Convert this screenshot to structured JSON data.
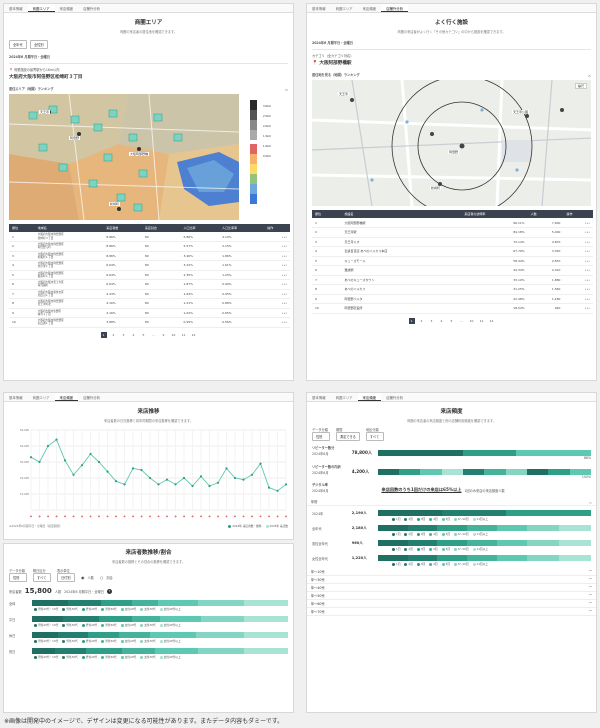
{
  "tabs": [
    "基本情報",
    "商圏エリア",
    "来店頻度",
    "店舗外分析"
  ],
  "p1": {
    "title": "商圏エリア",
    "subtitle": "商圏の来店者の居住地を確認できます。",
    "select_age": "全年代",
    "select_gender": "全性別",
    "period": "2024年6 月期平日・全曜日",
    "store_label": "商業施設の最寄駅から1Km以内",
    "store_name": "大阪府大阪市阿倍野区松崎町３丁目",
    "section": "居住エリア（地図）ランキング",
    "columns": [
      "順位",
      "地域名",
      "来店者数",
      "来店割合",
      "人口比率",
      "人口比率率",
      "操作"
    ],
    "rows": [
      [
        "1",
        "大阪府大阪市阿倍野区\n松崎町３丁目",
        "8.86%",
        "80",
        "5.86%",
        "4.10%"
      ],
      [
        "2",
        "大阪府大阪市阿倍野区\n阿倍野元町",
        "8.86%",
        "80",
        "5.57%",
        "2.15%"
      ],
      [
        "3",
        "大阪府大阪市阿倍野区\n昭和町１丁目",
        "8.86%",
        "80",
        "3.46%",
        "1.86%"
      ],
      [
        "4",
        "大阪府大阪市阿倍野区\n文の里１丁目",
        "6.64%",
        "80",
        "3.22%",
        "1.61%"
      ],
      [
        "5",
        "大阪府大阪市阿倍野区\n阪南町１丁目",
        "6.64%",
        "80",
        "2.35%",
        "1.25%"
      ],
      [
        "6",
        "大阪府大阪市天王寺区\n南河堀町",
        "6.64%",
        "80",
        "1.87%",
        "0.99%"
      ],
      [
        "7",
        "大阪府大阪市東住吉区\n北田辺１丁目",
        "4.43%",
        "80",
        "1.64%",
        "0.95%"
      ],
      [
        "8",
        "大阪府大阪市阿倍野区\n天王寺町北",
        "4.16%",
        "80",
        "1.21%",
        "0.88%"
      ],
      [
        "9",
        "大阪府大阪市生野区\n林寺１丁目",
        "4.16%",
        "80",
        "1.02%",
        "0.65%"
      ],
      [
        "10",
        "大阪府大阪市阿倍野区\n丸山通１丁目",
        "3.88%",
        "80",
        "0.99%",
        "0.56%"
      ]
    ],
    "pages": [
      "1",
      "2",
      "3",
      "4",
      "5",
      "…",
      "9",
      "10",
      "11",
      "12"
    ],
    "map_legend": [
      "3.0km",
      "2.5km",
      "2.0km",
      "1.5km",
      "1.0km",
      "0.5km"
    ],
    "stations": [
      "天王寺",
      "阿倍野",
      "大阪阿部野橋",
      "松崎町",
      "文の里"
    ]
  },
  "p2": {
    "title": "よく行く施設",
    "subtitle": "商圏の来店者がよく行く「その他カテゴリ」の中から施設を確認できます。",
    "period": "2024年6 月期平日・全曜日",
    "category_label": "カテゴリ（全カテゴリ対応）",
    "store_name": "大阪阿部野橋駅",
    "section": "居住地を見る（地図）ランキング",
    "columns": [
      "順位",
      "施設名",
      "来店者の訪問率",
      "人数",
      "操作"
    ],
    "rows": [
      [
        "1",
        "大阪阿部野橋駅",
        "96.11%",
        "7,900"
      ],
      [
        "2",
        "天王寺駅",
        "84.18%",
        "5,400"
      ],
      [
        "3",
        "天王寺ミオ",
        "72.14%",
        "4,870"
      ],
      [
        "4",
        "近鉄百貨店 あべのハルカス本店",
        "67.79%",
        "3,320"
      ],
      [
        "5",
        "キューズモール",
        "58.44%",
        "2,870"
      ],
      [
        "6",
        "難波駅",
        "44.34%",
        "2,410"
      ],
      [
        "7",
        "あべのキューズタウン",
        "33.10%",
        "1,880"
      ],
      [
        "8",
        "あべのハルカス",
        "31.25%",
        "1,560"
      ],
      [
        "9",
        "阿倍野ベルタ",
        "22.48%",
        "1,180"
      ],
      [
        "10",
        "阿倍野区役所",
        "18.54%",
        "940"
      ]
    ],
    "pages": [
      "1",
      "2",
      "3",
      "4",
      "5",
      "…",
      "10",
      "11",
      "12"
    ],
    "map_control": "縮尺",
    "map_labels": [
      "天王寺",
      "阿倍野",
      "天王寺公園",
      "阿倍野筋",
      "松崎町",
      "昭和町"
    ]
  },
  "p3": {
    "title": "来店推移",
    "subtitle": "来店者数の日次推移と前年同期間の来店推移を確認できます。",
    "note": "※2024年6月期平日・全曜日（指定期間）",
    "legend_a": "2024年 来店者数・推移",
    "legend_b": "2023年 来店数",
    "yticks": [
      "50,000",
      "40,000",
      "30,000",
      "20,000",
      "10,000"
    ],
    "chart_data": {
      "type": "line",
      "x_count": 31,
      "series": [
        {
          "name": "2024年 来店者数・推移",
          "values": [
            33000,
            30000,
            40000,
            44000,
            31000,
            22000,
            28000,
            35000,
            30000,
            24000,
            18000,
            16000,
            26000,
            25000,
            20000,
            16000,
            19000,
            16000,
            20000,
            15000,
            21000,
            15000,
            17000,
            26000,
            20000,
            19000,
            22000,
            29000,
            14000,
            12000,
            16000
          ]
        },
        {
          "name": "2023年 来店数",
          "values": [
            0,
            0,
            0,
            0,
            0,
            0,
            0,
            0,
            0,
            0,
            0,
            0,
            0,
            0,
            0,
            0,
            0,
            0,
            0,
            0,
            0,
            0,
            0,
            0,
            0,
            0,
            0,
            0,
            0,
            0,
            0
          ]
        }
      ],
      "ylim": [
        0,
        50000
      ]
    }
  },
  "p4": {
    "title": "来店者数推移/割合",
    "subtitle": "来店者数の推移とその割合の推移を確認できます。",
    "filters": [
      {
        "label": "データ分類",
        "value": "性別"
      },
      {
        "label": "曜日区分",
        "value": "すべて"
      },
      {
        "label": "表示単位",
        "value": "日付別"
      }
    ],
    "radio_a": "人数",
    "radio_b": "割合",
    "visitors_label": "来店者数",
    "visitors_value": "15,800",
    "visitors_unit": "人数",
    "visitors_sub": "2024年6 月期平日・全曜日",
    "bars": [
      {
        "label": "全体",
        "segs": [
          14,
          13,
          12,
          10,
          16,
          18,
          17
        ]
      },
      {
        "label": "平日",
        "segs": [
          12,
          14,
          13,
          11,
          16,
          17,
          17
        ]
      },
      {
        "label": "休日",
        "segs": [
          10,
          12,
          12,
          12,
          18,
          19,
          17
        ]
      },
      {
        "label": "祝日",
        "segs": [
          9,
          12,
          14,
          13,
          17,
          18,
          17
        ]
      }
    ],
    "legend": [
      "男性20代・10代",
      "男性30代",
      "男性40代",
      "男性50代",
      "女性20代",
      "女性30代",
      "女性40代以上"
    ]
  },
  "p5": {
    "title": "来店頻度",
    "subtitle": "商圏の来店者の来店頻度と他の店舗利用頻度を確認できます。",
    "filters": [
      {
        "label": "データ分類",
        "value": "性別"
      },
      {
        "label": "期間",
        "value": "測定できる"
      },
      {
        "label": "地区分類",
        "value": "すべて"
      }
    ],
    "summary": [
      {
        "title": "リピーター数分",
        "period": "2024年6月",
        "value": "78,800人",
        "pct": "88%",
        "bars": [
          40,
          25,
          35
        ]
      },
      {
        "title": "リピーター数の内訳",
        "period": "2024年6月",
        "value": "4,200人",
        "pct": "100%",
        "bars": [
          10,
          10,
          10,
          10,
          10,
          10,
          10,
          10,
          10,
          10
        ]
      }
    ],
    "repeat_label": "デジタル率",
    "repeat_period": "2024年6月",
    "repeat_note": "来店回数のうち1回だけの来店は65%以上",
    "repeat_sub": "1回のみ来店の来店頻度人数",
    "section": "年別",
    "groups": [
      {
        "name": "2024年",
        "value": "2,190人",
        "segs": [
          30,
          30,
          40
        ]
      },
      {
        "name": "全年代",
        "value": "2,180人",
        "segs": [
          14,
          14,
          14,
          14,
          14,
          15,
          15
        ]
      },
      {
        "name": "男性全年代",
        "value": "960人",
        "segs": [
          14,
          14,
          14,
          14,
          14,
          15,
          15
        ]
      },
      {
        "name": "女性全年代",
        "value": "1,220人",
        "segs": [
          14,
          14,
          14,
          14,
          14,
          15,
          15
        ]
      }
    ],
    "legend": [
      "1回",
      "2回",
      "3回",
      "4回",
      "5回",
      "6～10回",
      "11回以上"
    ],
    "collapses": [
      "年～10代",
      "年～30代",
      "年～40代",
      "年～50代",
      "年～60代",
      "年～70代"
    ]
  },
  "footnote": "※画像は開発中のイメージで、デザインは変更になる可能性があります。またデータ内容もダミーです。",
  "colors": {
    "dark": "#1f6f62",
    "mid": "#2f9e86",
    "light": "#5fc8b0",
    "pale": "#a8e3d4",
    "navy": "#3c4350"
  }
}
